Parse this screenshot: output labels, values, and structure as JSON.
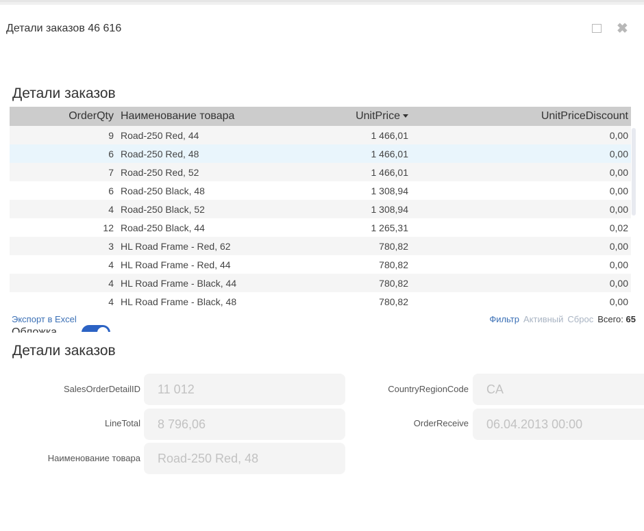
{
  "window": {
    "title": "Детали заказов 46 616"
  },
  "grid_section": {
    "title": "Детали заказов",
    "columns": {
      "qty": "OrderQty",
      "name": "Наименование товара",
      "price": "UnitPrice",
      "discount": "UnitPriceDiscount"
    },
    "rows": [
      {
        "qty": "9",
        "name": "Road-250 Red, 44",
        "price": "1 466,01",
        "discount": "0,00"
      },
      {
        "qty": "6",
        "name": "Road-250 Red, 48",
        "price": "1 466,01",
        "discount": "0,00"
      },
      {
        "qty": "7",
        "name": "Road-250 Red, 52",
        "price": "1 466,01",
        "discount": "0,00"
      },
      {
        "qty": "6",
        "name": "Road-250 Black, 48",
        "price": "1 308,94",
        "discount": "0,00"
      },
      {
        "qty": "4",
        "name": "Road-250 Black, 52",
        "price": "1 308,94",
        "discount": "0,00"
      },
      {
        "qty": "12",
        "name": "Road-250 Black, 44",
        "price": "1 265,31",
        "discount": "0,02"
      },
      {
        "qty": "3",
        "name": "HL Road Frame - Red, 62",
        "price": "780,82",
        "discount": "0,00"
      },
      {
        "qty": "4",
        "name": "HL Road Frame - Red, 44",
        "price": "780,82",
        "discount": "0,00"
      },
      {
        "qty": "4",
        "name": "HL Road Frame - Black, 44",
        "price": "780,82",
        "discount": "0,00"
      },
      {
        "qty": "4",
        "name": "HL Road Frame - Black, 48",
        "price": "780,82",
        "discount": "0,00"
      }
    ],
    "export_label": "Экспорт в Excel",
    "toggle_label": "Обложка",
    "filter_label": "Фильтр",
    "active_label": "Активный",
    "reset_label": "Сброс",
    "total_label": "Всего:",
    "total_value": "65"
  },
  "detail_section": {
    "title": "Детали заказов",
    "fields": {
      "sales_order_detail_id": {
        "label": "SalesOrderDetailID",
        "value": "11 012"
      },
      "line_total": {
        "label": "LineTotal",
        "value": "8 796,06"
      },
      "product_name": {
        "label": "Наименование товара",
        "value": "Road-250 Red, 48"
      },
      "country_region_code": {
        "label": "CountryRegionCode",
        "value": "CA"
      },
      "order_receive": {
        "label": "OrderReceive",
        "value": "06.04.2013 00:00"
      }
    }
  }
}
